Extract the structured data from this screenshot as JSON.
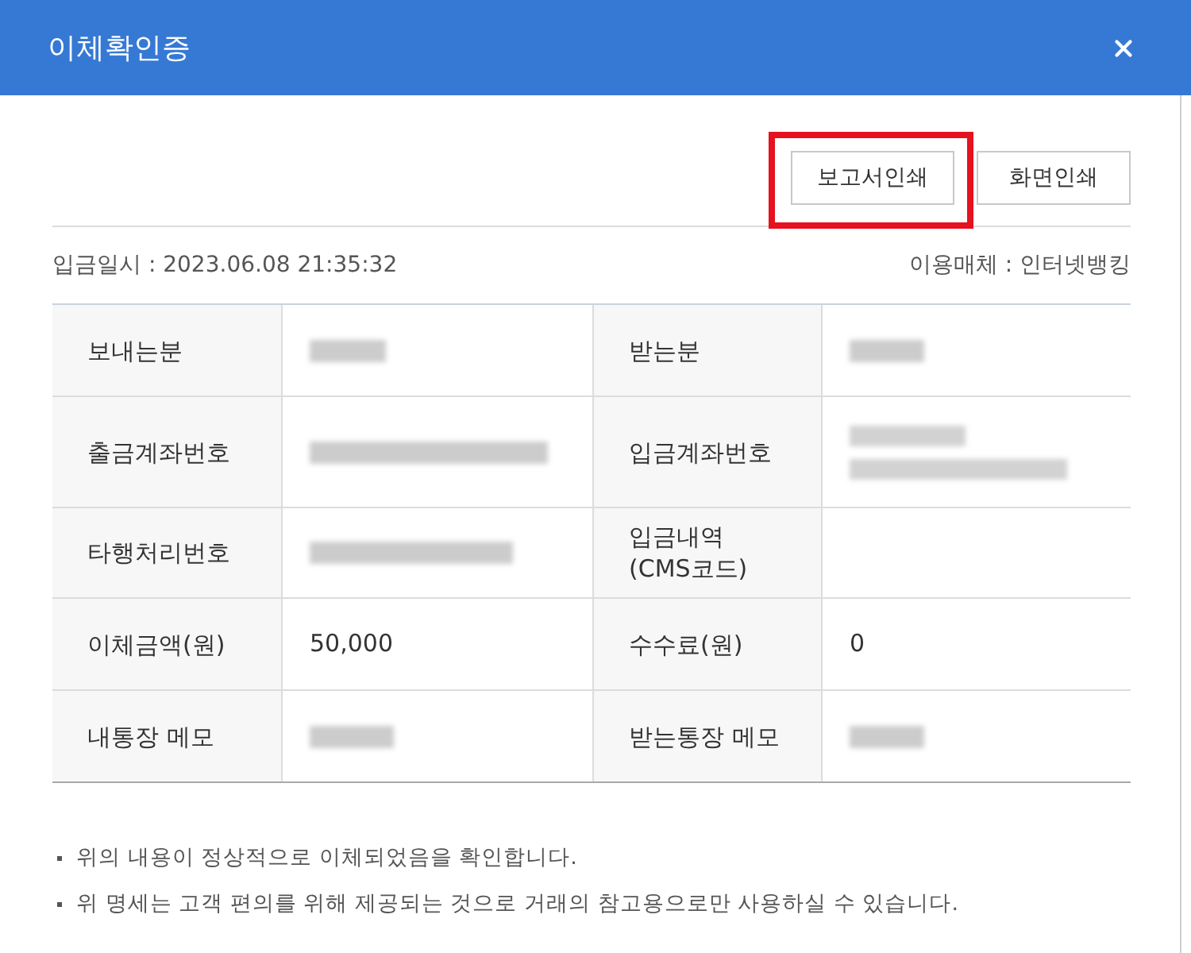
{
  "dialog": {
    "title": "이체확인증"
  },
  "buttons": [
    {
      "label": "보고서인쇄",
      "highlighted": true
    },
    {
      "label": "화면인쇄",
      "highlighted": false
    }
  ],
  "info": {
    "date": "입금일시 : 2023.06.08 21:35:32",
    "channel": "이용매체 : 인터넷뱅킹"
  },
  "table": {
    "rows": [
      {
        "cells": [
          {
            "label": "보내는분",
            "kind": "blurred"
          },
          {
            "label": "받는분",
            "kind": "blurred"
          }
        ]
      },
      {
        "cells": [
          {
            "label": "출금계좌번호",
            "kind": "blurred"
          },
          {
            "label": "입금계좌번호",
            "kind": "multiblur"
          }
        ]
      },
      {
        "cells": [
          {
            "label": "타행처리번호",
            "kind": "blurred"
          },
          {
            "label": "입금내역 (CMS코드)",
            "kind": "empty"
          }
        ]
      },
      {
        "cells": [
          {
            "label": "이체금액(원)",
            "kind": "text",
            "value": "50,000"
          },
          {
            "label": "수수료(원)",
            "kind": "text",
            "value": "0"
          }
        ]
      },
      {
        "cells": [
          {
            "label": "내통장 메모",
            "kind": "blurred"
          },
          {
            "label": "받는통장 메모",
            "kind": "blurred"
          }
        ]
      }
    ]
  },
  "notes": [
    "위의 내용이 정상적으로 이체되었음을 확인합니다.",
    "위 명세는 고객 편의를 위해 제공되는 것으로 거래의 참고용으로만 사용하실 수 있습니다."
  ]
}
